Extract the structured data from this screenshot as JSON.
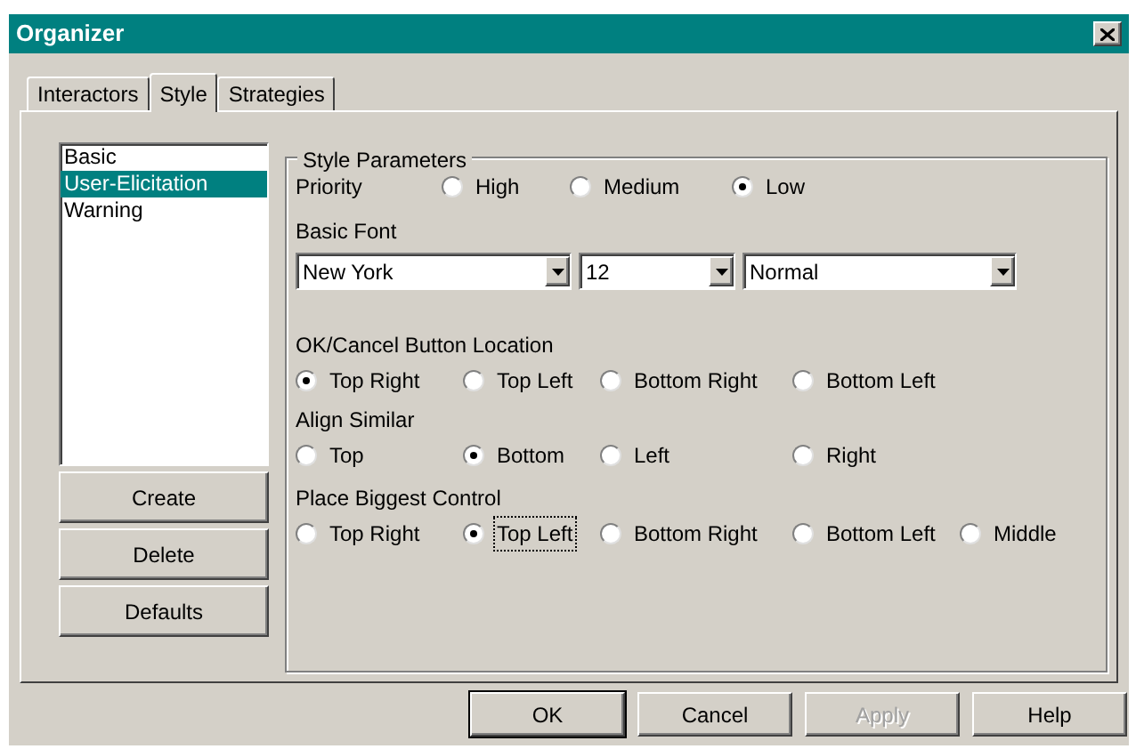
{
  "window": {
    "title": "Organizer"
  },
  "tabs": [
    {
      "label": "Interactors",
      "selected": false
    },
    {
      "label": "Style",
      "selected": true
    },
    {
      "label": "Strategies",
      "selected": false
    }
  ],
  "style_list": [
    {
      "label": "Basic",
      "selected": false
    },
    {
      "label": "User-Elicitation",
      "selected": true
    },
    {
      "label": "Warning",
      "selected": false
    }
  ],
  "side_buttons": [
    "Create",
    "Delete",
    "Defaults"
  ],
  "style_parameters": {
    "title": "Style Parameters",
    "priority": {
      "label": "Priority",
      "options": [
        {
          "label": "High",
          "selected": false
        },
        {
          "label": "Medium",
          "selected": false
        },
        {
          "label": "Low",
          "selected": true
        }
      ]
    },
    "basic_font": {
      "label": "Basic Font",
      "dropdowns": [
        {
          "value": "New York"
        },
        {
          "value": "12"
        },
        {
          "value": "Normal"
        }
      ]
    },
    "button_location": {
      "label": "OK/Cancel Button Location",
      "options": [
        {
          "label": "Top Right",
          "selected": true,
          "focused": false
        },
        {
          "label": "Top Left",
          "selected": false,
          "focused": false
        },
        {
          "label": "Bottom Right",
          "selected": false,
          "focused": false
        },
        {
          "label": "Bottom Left",
          "selected": false,
          "focused": false
        }
      ]
    },
    "align_similar": {
      "label": "Align Similar",
      "options": [
        {
          "label": "Top",
          "selected": false,
          "focused": false
        },
        {
          "label": "Bottom",
          "selected": true,
          "focused": false
        },
        {
          "label": "Left",
          "selected": false,
          "focused": false
        },
        {
          "label": "Right",
          "selected": false,
          "focused": false
        }
      ]
    },
    "place_biggest_control": {
      "label": "Place Biggest Control",
      "options": [
        {
          "label": "Top Right",
          "selected": false,
          "focused": false
        },
        {
          "label": "Top Left",
          "selected": true,
          "focused": true
        },
        {
          "label": "Bottom Right",
          "selected": false,
          "focused": false
        },
        {
          "label": "Bottom Left",
          "selected": false,
          "focused": false
        },
        {
          "label": "Middle",
          "selected": false,
          "focused": false
        }
      ]
    }
  },
  "bottom_buttons": [
    {
      "label": "OK",
      "default": true,
      "disabled": false
    },
    {
      "label": "Cancel",
      "default": false,
      "disabled": false
    },
    {
      "label": "Apply",
      "default": false,
      "disabled": true
    },
    {
      "label": "Help",
      "default": false,
      "disabled": false
    }
  ]
}
